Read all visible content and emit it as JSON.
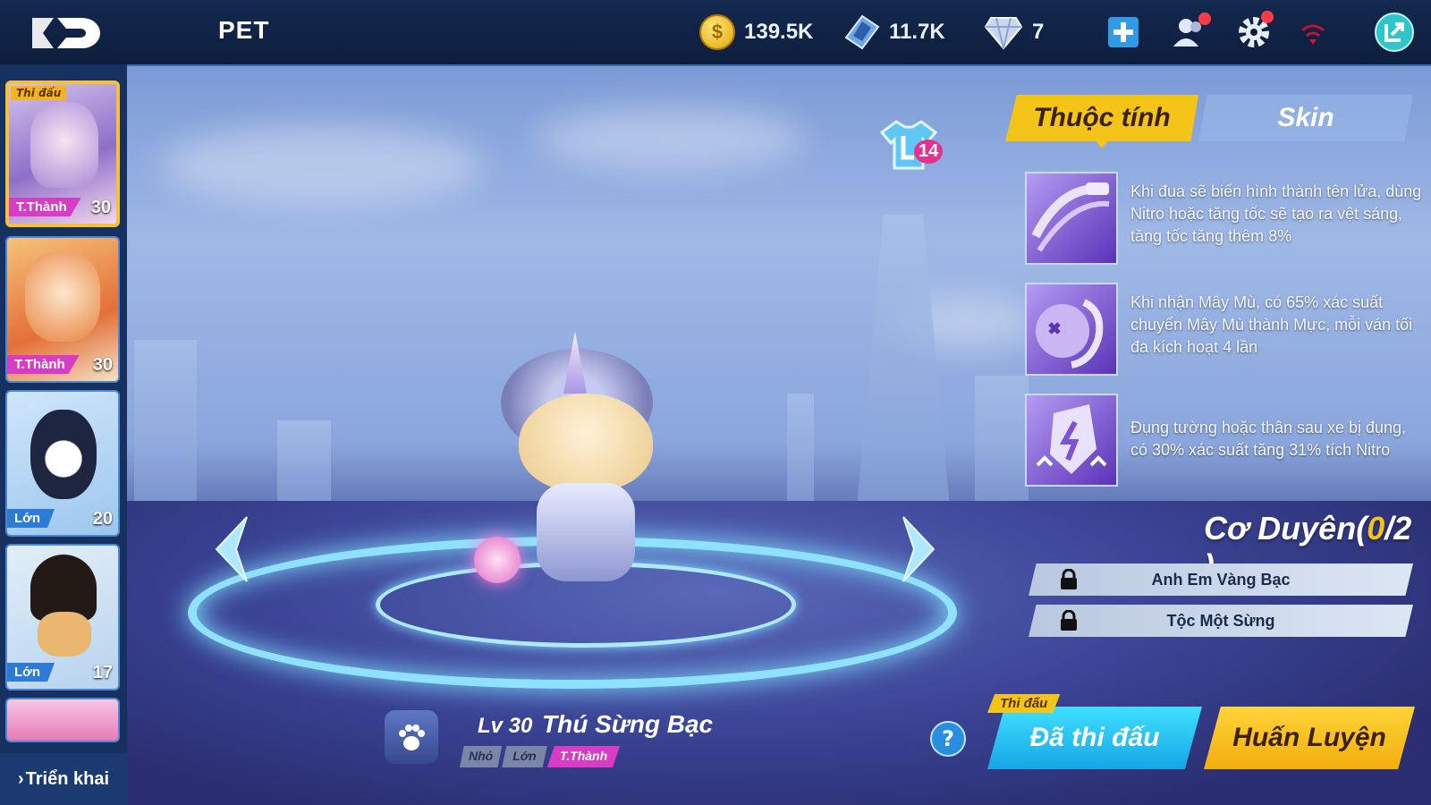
{
  "header": {
    "title": "PET",
    "gold": "139.5K",
    "tokens": "11.7K",
    "diamonds": "7"
  },
  "sidebar": {
    "cards": [
      {
        "badge": "Thi đấu",
        "tag": "T.Thành",
        "level": "30",
        "tag_color": "#d63cc4"
      },
      {
        "badge": "",
        "tag": "T.Thành",
        "level": "30",
        "tag_color": "#d63cc4"
      },
      {
        "badge": "",
        "tag": "Lớn",
        "level": "20",
        "tag_color": "#2c7bd6"
      },
      {
        "badge": "",
        "tag": "Lớn",
        "level": "17",
        "tag_color": "#2c7bd6"
      }
    ],
    "expand_label": "Triển khai"
  },
  "stage": {
    "shirt_count": "14"
  },
  "panel": {
    "tab_active": "Thuộc tính",
    "tab_inactive": "Skin",
    "skills": [
      {
        "text": "Khi đua sẽ biến hình thành tên lửa, dùng Nitro hoặc tăng tốc sẽ tạo ra vệt sáng, tăng tốc tăng thêm 8%"
      },
      {
        "text": "Khi nhận Mây Mù, có 65% xác suất chuyển Mây Mù thành Mực, mỗi ván tối đa kích hoạt 4 lần"
      },
      {
        "text": "Đụng tường hoặc thân sau xe bị đụng, có 30% xác suất tăng 31% tích Nitro"
      }
    ],
    "coduyen_label": "Cơ Duyên(",
    "coduyen_count": "0",
    "coduyen_total": "/2 )",
    "bonds": [
      "Anh Em Vàng Bạc",
      "Tộc Một Sừng"
    ]
  },
  "pet": {
    "level": "Lv 30",
    "name": "Thú Sừng Bạc",
    "stages": [
      "Nhỏ",
      "Lớn",
      "T.Thành"
    ]
  },
  "buttons": {
    "compete_badge": "Thi đấu",
    "compete": "Đã thi đấu",
    "train": "Huấn Luyện",
    "help": "?"
  },
  "colors": {
    "accent_yellow": "#f5c418",
    "accent_cyan": "#1ec6f4",
    "ring_glow": "#7fd8ff"
  }
}
